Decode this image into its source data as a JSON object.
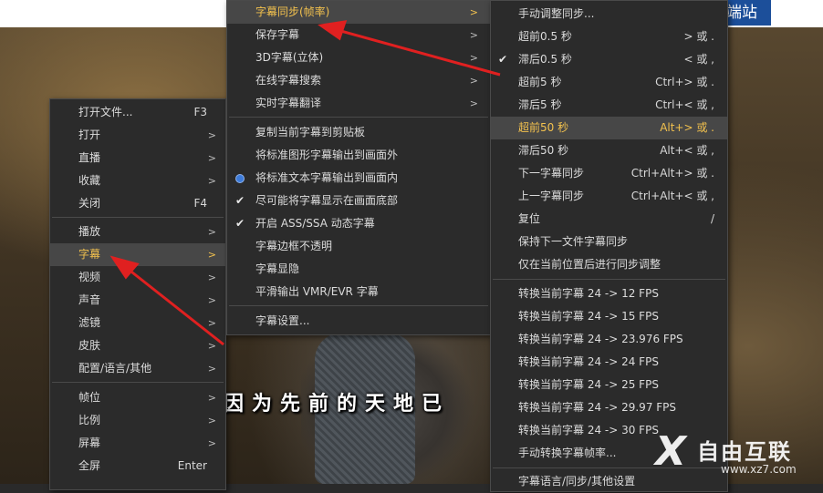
{
  "brand": {
    "top_strip_text": "端站"
  },
  "video": {
    "subtitle": "因为先前的天地已"
  },
  "menu_main": {
    "items": [
      {
        "label": "打开文件...",
        "shortcut": "F3",
        "submenu": false
      },
      {
        "label": "打开",
        "shortcut": "",
        "submenu": true
      },
      {
        "label": "直播",
        "shortcut": "",
        "submenu": true
      },
      {
        "label": "收藏",
        "shortcut": "",
        "submenu": true
      },
      {
        "label": "关闭",
        "shortcut": "F4",
        "submenu": false
      },
      {
        "label": "播放",
        "shortcut": "",
        "submenu": true
      },
      {
        "label": "字幕",
        "shortcut": "",
        "submenu": true
      },
      {
        "label": "视频",
        "shortcut": "",
        "submenu": true
      },
      {
        "label": "声音",
        "shortcut": "",
        "submenu": true
      },
      {
        "label": "滤镜",
        "shortcut": "",
        "submenu": true
      },
      {
        "label": "皮肤",
        "shortcut": "",
        "submenu": true
      },
      {
        "label": "配置/语言/其他",
        "shortcut": "",
        "submenu": true
      },
      {
        "label": "帧位",
        "shortcut": "",
        "submenu": true
      },
      {
        "label": "比例",
        "shortcut": "",
        "submenu": true
      },
      {
        "label": "屏幕",
        "shortcut": "",
        "submenu": true
      },
      {
        "label": "全屏",
        "shortcut": "Enter",
        "submenu": false
      }
    ],
    "arrow": ">"
  },
  "menu_subtitle": {
    "items": [
      {
        "label": "字幕同步(帧率)",
        "submenu": true
      },
      {
        "label": "保存字幕",
        "submenu": true
      },
      {
        "label": "3D字幕(立体)",
        "submenu": true
      },
      {
        "label": "在线字幕搜索",
        "submenu": true
      },
      {
        "label": "实时字幕翻译",
        "submenu": true
      },
      {
        "label": "复制当前字幕到剪贴板",
        "submenu": false
      },
      {
        "label": "将标准图形字幕输出到画面外",
        "submenu": false
      },
      {
        "label": "将标准文本字幕输出到画面内",
        "submenu": false,
        "radio": true
      },
      {
        "label": "尽可能将字幕显示在画面底部",
        "submenu": false,
        "check": true
      },
      {
        "label": "开启 ASS/SSA 动态字幕",
        "submenu": false,
        "check": true
      },
      {
        "label": "字幕边框不透明",
        "submenu": false
      },
      {
        "label": "字幕显隐",
        "submenu": false
      },
      {
        "label": "平滑输出 VMR/EVR 字幕",
        "submenu": false
      },
      {
        "label": "字幕设置...",
        "submenu": false
      }
    ],
    "arrow": ">",
    "check_mark": "✔"
  },
  "menu_sync": {
    "items": [
      {
        "label": "手动调整同步...",
        "shortcut": ""
      },
      {
        "label": "超前0.5 秒",
        "shortcut": "> 或 ."
      },
      {
        "label": "滞后0.5 秒",
        "shortcut": "< 或 ,",
        "check": true
      },
      {
        "label": "超前5 秒",
        "shortcut": "Ctrl+> 或 ."
      },
      {
        "label": "滞后5 秒",
        "shortcut": "Ctrl+< 或 ,"
      },
      {
        "label": "超前50 秒",
        "shortcut": "Alt+> 或 ."
      },
      {
        "label": "滞后50 秒",
        "shortcut": "Alt+< 或 ,"
      },
      {
        "label": "下一字幕同步",
        "shortcut": "Ctrl+Alt+> 或 ."
      },
      {
        "label": "上一字幕同步",
        "shortcut": "Ctrl+Alt+< 或 ,"
      },
      {
        "label": "复位",
        "shortcut": "/"
      },
      {
        "label": "保持下一文件字幕同步",
        "shortcut": ""
      },
      {
        "label": "仅在当前位置后进行同步调整",
        "shortcut": ""
      },
      {
        "label": "转换当前字幕 24 -> 12 FPS",
        "shortcut": ""
      },
      {
        "label": "转换当前字幕 24 -> 15 FPS",
        "shortcut": ""
      },
      {
        "label": "转换当前字幕 24 -> 23.976 FPS",
        "shortcut": ""
      },
      {
        "label": "转换当前字幕 24 -> 24 FPS",
        "shortcut": ""
      },
      {
        "label": "转换当前字幕 24 -> 25 FPS",
        "shortcut": ""
      },
      {
        "label": "转换当前字幕 24 -> 29.97 FPS",
        "shortcut": ""
      },
      {
        "label": "转换当前字幕 24 -> 30 FPS",
        "shortcut": ""
      },
      {
        "label": "手动转换字幕帧率...",
        "shortcut": ""
      },
      {
        "label": "字幕语言/同步/其他设置",
        "shortcut": ""
      }
    ],
    "check_mark": "✔"
  },
  "watermark": {
    "logo_char": "X",
    "name": "自由互联",
    "url": "www.xz7.com"
  },
  "colors": {
    "menu_bg": "#2b2b2b",
    "highlight_text": "#f2c14e",
    "annotation_arrow": "#e02020",
    "radio": "#3d7bd9"
  }
}
